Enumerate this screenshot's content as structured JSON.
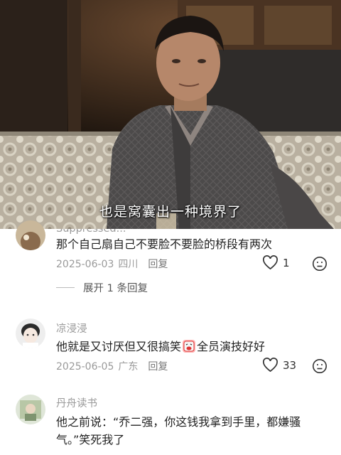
{
  "video": {
    "subtitle": "也是窝囊出一种境界了"
  },
  "comments": [
    {
      "username": "Suppressed...",
      "text": "那个自己扇自己不要脸不要脸的桥段有两次",
      "date": "2025-06-03",
      "location": "四川",
      "reply_label": "回复",
      "likes": "1",
      "expand_label": "展开 1 条回复"
    },
    {
      "username": "凉浸浸",
      "text_before": "他就是又讨厌但又很搞笑",
      "emoji": "crying-laughing-emoji",
      "text_after": "全员演技好好",
      "date": "2025-06-05",
      "location": "广东",
      "reply_label": "回复",
      "likes": "33"
    },
    {
      "username": "丹舟读书",
      "text": "他之前说：“乔二强，你这钱我拿到手里，都嫌骚气。”笑死我了"
    }
  ],
  "icons": {
    "like": "heart-icon",
    "dislike": "thumbs-down-face-icon"
  }
}
